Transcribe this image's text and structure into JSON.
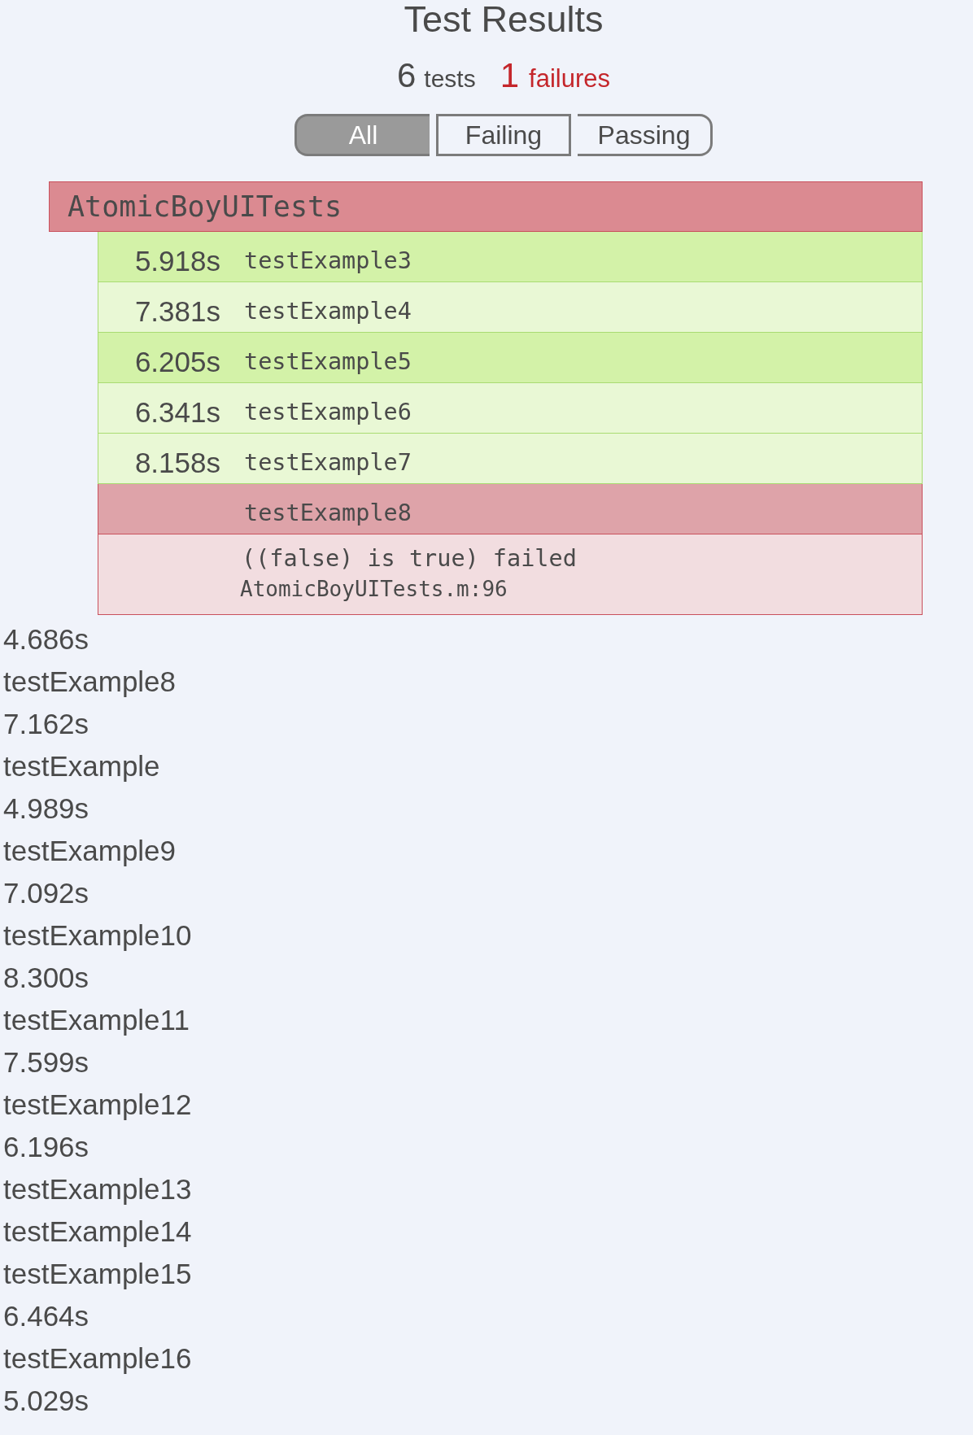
{
  "title": "Test Results",
  "summary": {
    "tests_count": "6",
    "tests_label": "tests",
    "failures_count": "1",
    "failures_label": "failures"
  },
  "filter_tabs": [
    {
      "label": "All",
      "selected": true
    },
    {
      "label": "Failing",
      "selected": false
    },
    {
      "label": "Passing",
      "selected": false
    }
  ],
  "suite": {
    "name": "AtomicBoyUITests",
    "failed": true,
    "tests": [
      {
        "duration": "5.918s",
        "name": "testExample3",
        "failed": false,
        "color": "#d3f2a8"
      },
      {
        "duration": "7.381s",
        "name": "testExample4",
        "failed": false,
        "color": "#e9f8d5"
      },
      {
        "duration": "6.205s",
        "name": "testExample5",
        "failed": false,
        "color": "#d3f2a8"
      },
      {
        "duration": "6.341s",
        "name": "testExample6",
        "failed": false,
        "color": "#e9f8d5"
      },
      {
        "duration": "8.158s",
        "name": "testExample7",
        "failed": false,
        "color": "#e9f8d5"
      },
      {
        "name": "testExample8",
        "failed": true,
        "color": "#dea3a9",
        "failure": {
          "message": "((false) is true) failed",
          "location": "AtomicBoyUITests.m:96"
        }
      }
    ]
  },
  "unstyled_results": [
    {
      "duration": "4.686s",
      "name": "testExample8"
    },
    {
      "duration": "7.162s",
      "name": "testExample"
    },
    {
      "duration": "4.989s",
      "name": "testExample9"
    },
    {
      "duration": "7.092s",
      "name": "testExample10"
    },
    {
      "duration": "8.300s",
      "name": "testExample11"
    },
    {
      "duration": "7.599s",
      "name": "testExample12"
    },
    {
      "duration": "6.196s",
      "name": "testExample13"
    },
    {
      "name": "testExample14"
    },
    {
      "name": "testExample15"
    },
    {
      "duration": "6.464s",
      "name": "testExample16"
    },
    {
      "duration": "5.029s"
    }
  ]
}
